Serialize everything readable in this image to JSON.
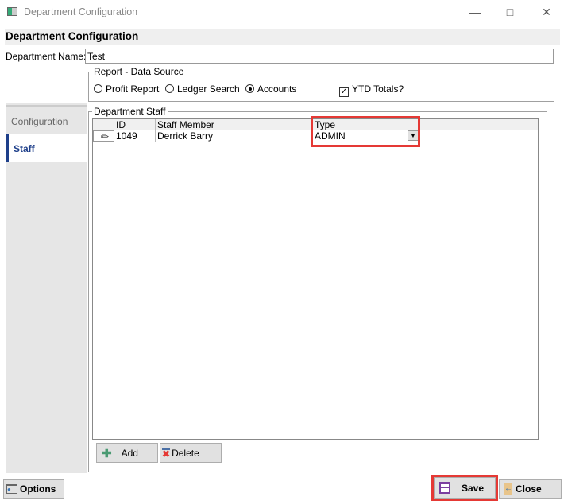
{
  "window": {
    "title": "Department Configuration"
  },
  "header": {
    "title": "Department Configuration"
  },
  "form": {
    "dept_name_label": "Department Name:",
    "dept_name_value": "Test"
  },
  "report": {
    "legend": "Report - Data Source",
    "options": [
      "Profit Report",
      "Ledger Search",
      "Accounts"
    ],
    "selected": "Accounts",
    "ytd_label": "YTD Totals?",
    "ytd_checked": true
  },
  "tabs": [
    {
      "label": "Configuration"
    },
    {
      "label": "Staff"
    }
  ],
  "staff": {
    "legend": "Department Staff",
    "columns": [
      "ID",
      "Staff Member",
      "Type"
    ],
    "rows": [
      {
        "id": "1049",
        "name": "Derrick Barry",
        "type": "ADMIN"
      }
    ],
    "add_label": "Add",
    "delete_label": "Delete"
  },
  "footer": {
    "options_label": "Options",
    "save_label": "Save",
    "close_label": "Close"
  },
  "colors": {
    "highlight": "#e53935",
    "active_tab": "#1e3f8a"
  }
}
